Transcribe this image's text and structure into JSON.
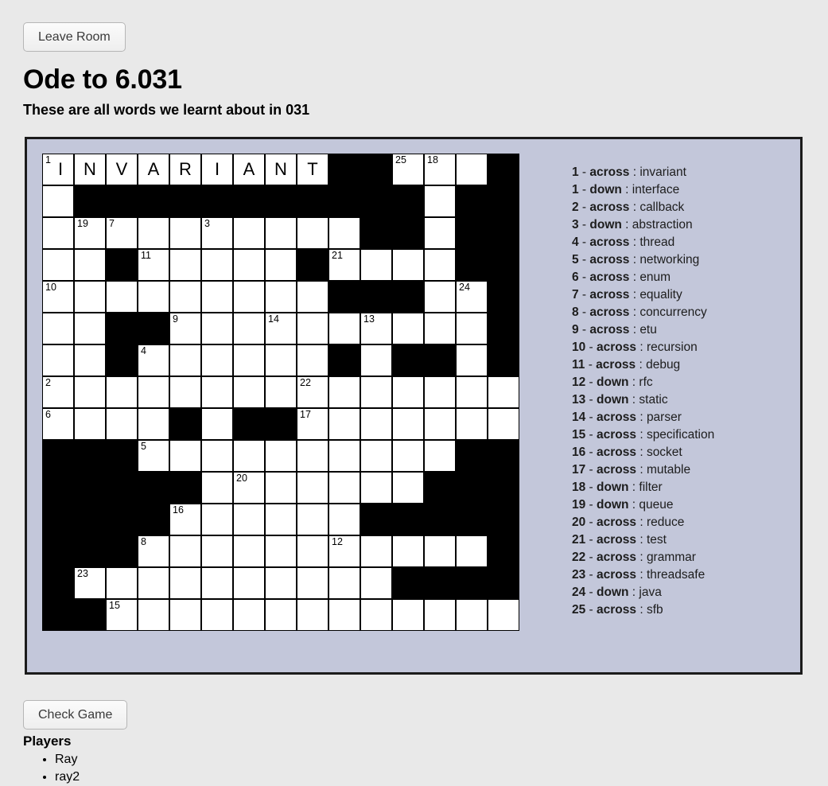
{
  "header": {
    "leave_button": "Leave Room",
    "title": "Ode to 6.031",
    "subtitle": "These are all words we learnt about in 031"
  },
  "footer": {
    "check_button": "Check Game",
    "players_title": "Players",
    "players": [
      "Ray",
      "ray2"
    ]
  },
  "colors": {
    "page_background": "#e9e9e9",
    "panel_background": "#c3c7da",
    "panel_border": "#1b1b1b",
    "cell_open": "#ffffff",
    "cell_block": "#000000"
  },
  "grid": {
    "rows": 15,
    "cols": 15,
    "cell_size": 40,
    "layout": [
      "OOOOOOOOO##OOO#",
      "O###########O##",
      "OOOOOOOOOO##O##",
      "OO#OOOOO#OOOO##",
      "OOOOOOOOO###OO#",
      "OO##OOOOOOOOOO#",
      "OO#OOOOOO#O##O#",
      "OOOOOOOOOOOOOOO",
      "OOOO#O##OOOOOOO",
      "###OOOOOOOOOO##",
      "#####OOOOOOO###",
      "####OOOOOO#####",
      "###OOOOOOOOOOO#",
      "#OOOOOOOOOO####",
      "##OOOOOOOOOOOOO"
    ],
    "numbers": [
      {
        "row": 0,
        "col": 0,
        "n": "1"
      },
      {
        "row": 0,
        "col": 11,
        "n": "25"
      },
      {
        "row": 0,
        "col": 12,
        "n": "18"
      },
      {
        "row": 2,
        "col": 1,
        "n": "19"
      },
      {
        "row": 2,
        "col": 2,
        "n": "7"
      },
      {
        "row": 2,
        "col": 5,
        "n": "3"
      },
      {
        "row": 3,
        "col": 3,
        "n": "11"
      },
      {
        "row": 3,
        "col": 9,
        "n": "21"
      },
      {
        "row": 4,
        "col": 0,
        "n": "10"
      },
      {
        "row": 4,
        "col": 13,
        "n": "24"
      },
      {
        "row": 5,
        "col": 4,
        "n": "9"
      },
      {
        "row": 5,
        "col": 7,
        "n": "14"
      },
      {
        "row": 5,
        "col": 10,
        "n": "13"
      },
      {
        "row": 6,
        "col": 3,
        "n": "4"
      },
      {
        "row": 7,
        "col": 0,
        "n": "2"
      },
      {
        "row": 7,
        "col": 8,
        "n": "22"
      },
      {
        "row": 8,
        "col": 0,
        "n": "6"
      },
      {
        "row": 8,
        "col": 8,
        "n": "17"
      },
      {
        "row": 9,
        "col": 3,
        "n": "5"
      },
      {
        "row": 10,
        "col": 6,
        "n": "20"
      },
      {
        "row": 11,
        "col": 4,
        "n": "16"
      },
      {
        "row": 12,
        "col": 3,
        "n": "8"
      },
      {
        "row": 12,
        "col": 9,
        "n": "12"
      },
      {
        "row": 13,
        "col": 1,
        "n": "23"
      },
      {
        "row": 14,
        "col": 2,
        "n": "15"
      }
    ],
    "letters": [
      {
        "row": 0,
        "col": 0,
        "ch": "I"
      },
      {
        "row": 0,
        "col": 1,
        "ch": "N"
      },
      {
        "row": 0,
        "col": 2,
        "ch": "V"
      },
      {
        "row": 0,
        "col": 3,
        "ch": "A"
      },
      {
        "row": 0,
        "col": 4,
        "ch": "R"
      },
      {
        "row": 0,
        "col": 5,
        "ch": "I"
      },
      {
        "row": 0,
        "col": 6,
        "ch": "A"
      },
      {
        "row": 0,
        "col": 7,
        "ch": "N"
      },
      {
        "row": 0,
        "col": 8,
        "ch": "T"
      }
    ]
  },
  "clues": [
    {
      "num": "1",
      "dir": "across",
      "word": "invariant"
    },
    {
      "num": "1",
      "dir": "down",
      "word": "interface"
    },
    {
      "num": "2",
      "dir": "across",
      "word": "callback"
    },
    {
      "num": "3",
      "dir": "down",
      "word": "abstraction"
    },
    {
      "num": "4",
      "dir": "across",
      "word": "thread"
    },
    {
      "num": "5",
      "dir": "across",
      "word": "networking"
    },
    {
      "num": "6",
      "dir": "across",
      "word": "enum"
    },
    {
      "num": "7",
      "dir": "across",
      "word": "equality"
    },
    {
      "num": "8",
      "dir": "across",
      "word": "concurrency"
    },
    {
      "num": "9",
      "dir": "across",
      "word": "etu"
    },
    {
      "num": "10",
      "dir": "across",
      "word": "recursion"
    },
    {
      "num": "11",
      "dir": "across",
      "word": "debug"
    },
    {
      "num": "12",
      "dir": "down",
      "word": "rfc"
    },
    {
      "num": "13",
      "dir": "down",
      "word": "static"
    },
    {
      "num": "14",
      "dir": "across",
      "word": "parser"
    },
    {
      "num": "15",
      "dir": "across",
      "word": "specification"
    },
    {
      "num": "16",
      "dir": "across",
      "word": "socket"
    },
    {
      "num": "17",
      "dir": "across",
      "word": "mutable"
    },
    {
      "num": "18",
      "dir": "down",
      "word": "filter"
    },
    {
      "num": "19",
      "dir": "down",
      "word": "queue"
    },
    {
      "num": "20",
      "dir": "across",
      "word": "reduce"
    },
    {
      "num": "21",
      "dir": "across",
      "word": "test"
    },
    {
      "num": "22",
      "dir": "across",
      "word": "grammar"
    },
    {
      "num": "23",
      "dir": "across",
      "word": "threadsafe"
    },
    {
      "num": "24",
      "dir": "down",
      "word": "java"
    },
    {
      "num": "25",
      "dir": "across",
      "word": "sfb"
    }
  ]
}
